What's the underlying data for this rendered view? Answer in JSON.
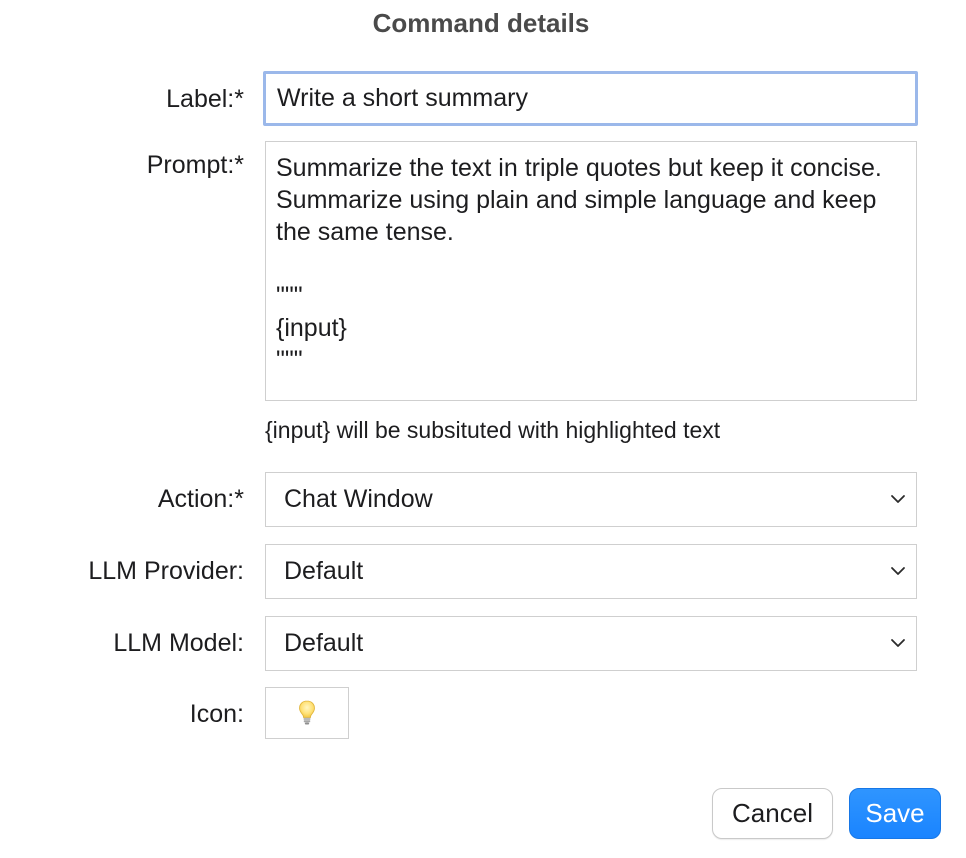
{
  "dialog": {
    "title": "Command details"
  },
  "form": {
    "label": {
      "caption": "Label:*",
      "value": "Write a short summary"
    },
    "prompt": {
      "caption": "Prompt:*",
      "value": "Summarize the text in triple quotes but keep it concise. Summarize using plain and simple language and keep the same tense.\n\n\"\"\"\n{input}\n\"\"\"",
      "hint": "{input} will be subsituted with highlighted text"
    },
    "action": {
      "caption": "Action:*",
      "value": "Chat Window"
    },
    "llm_provider": {
      "caption": "LLM Provider:",
      "value": "Default"
    },
    "llm_model": {
      "caption": "LLM Model:",
      "value": "Default"
    },
    "icon": {
      "caption": "Icon:",
      "value": "lightbulb-icon"
    }
  },
  "buttons": {
    "cancel_label": "Cancel",
    "save_label": "Save"
  },
  "colors": {
    "accent": "#1a84ff",
    "focus_ring": "#9bb8ea",
    "border": "#cfcfcf"
  }
}
